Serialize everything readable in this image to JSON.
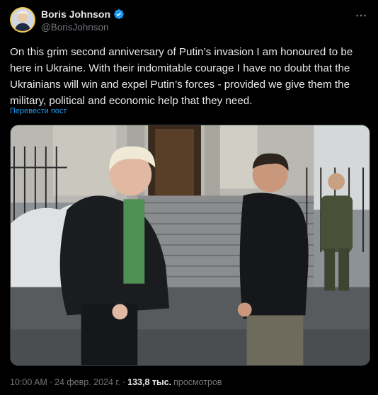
{
  "author": {
    "display_name": "Boris Johnson",
    "handle": "@BorisJohnson",
    "verified_icon": "verified-badge-icon",
    "avatar_icon": "avatar",
    "colors": {
      "avatar_ring": "#f2c94c",
      "verified": "#1d9bf0"
    }
  },
  "tweet": {
    "text": "On this grim second anniversary of Putin’s invasion I am honoured to be here in Ukraine. With their indomitable courage I have no doubt that the Ukrainians will win and expel Putin’s forces - provided we give them the military, political and economic help that they need.",
    "translate_label": "Перевести пост",
    "media_icon": "photo-image"
  },
  "meta": {
    "time": "10:00 AM",
    "separator": "·",
    "date": "24 февр. 2024 г.",
    "views_count": "133,8 тыс.",
    "views_label": "просмотров"
  },
  "colors": {
    "background": "#000000",
    "text": "#e7e9ea",
    "secondary": "#71767b",
    "link": "#1d9bf0"
  }
}
